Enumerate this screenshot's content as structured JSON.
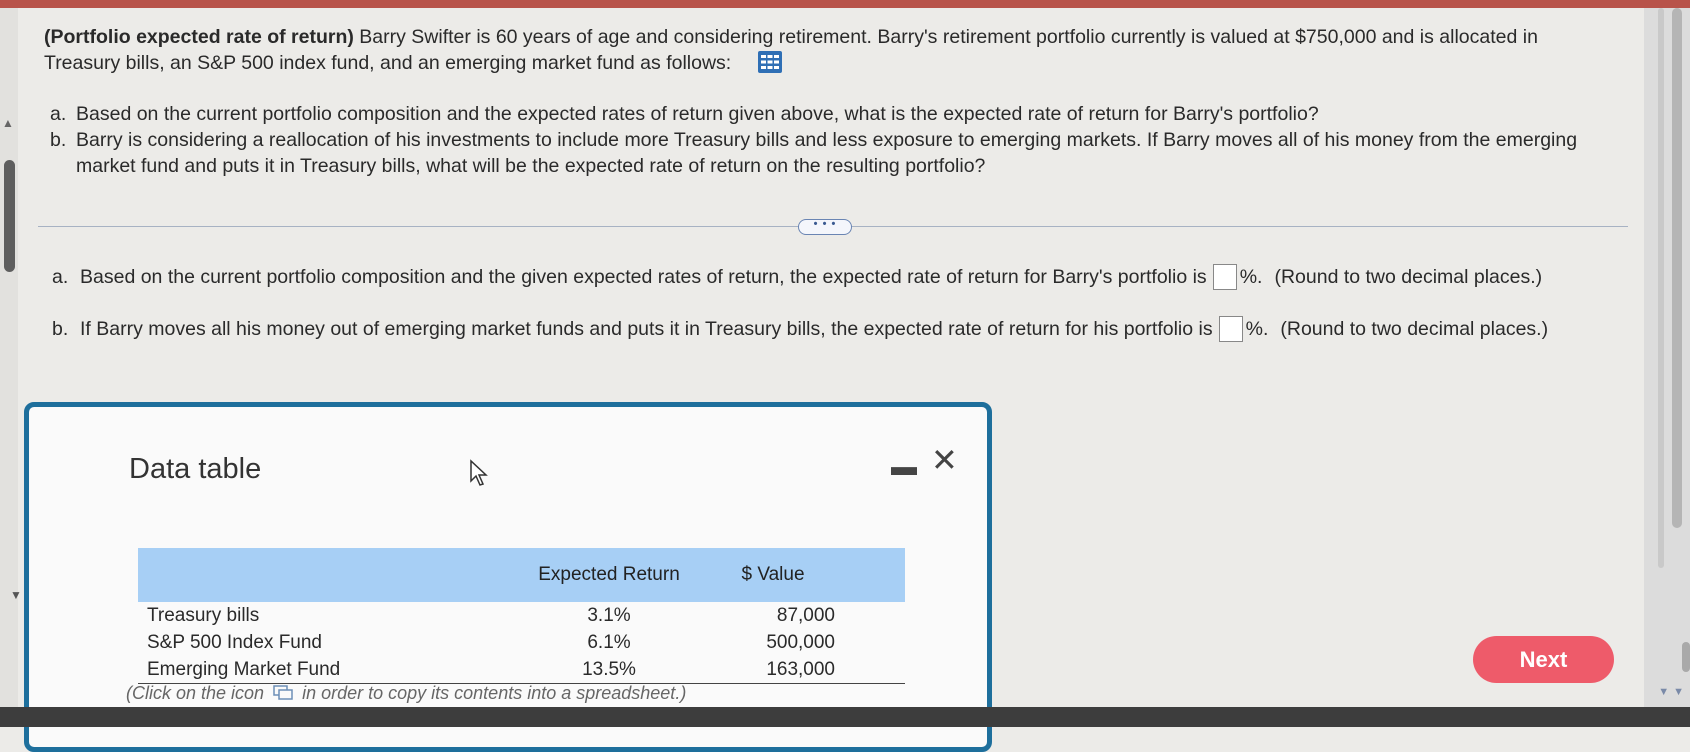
{
  "question": {
    "title": "(Portfolio expected rate of return)",
    "intro": "Barry Swifter is 60 years of age and considering retirement. Barry's retirement portfolio currently is valued at $750,000 and is allocated in Treasury bills, an S&P 500 index fund, and an emerging market fund as follows:",
    "parts": [
      {
        "label": "a.",
        "text": "Based on the current portfolio composition and the expected rates of return given above, what is the expected rate of return for Barry's portfolio?"
      },
      {
        "label": "b.",
        "text": "Barry is considering a reallocation of his investments to include more Treasury bills and less exposure to emerging markets. If Barry moves all of his money from the emerging market fund and puts it in Treasury bills, what will be the expected rate of return on the resulting portfolio?"
      }
    ]
  },
  "more_label": "• • •",
  "answers": [
    {
      "label": "a.",
      "prefix": "Based on the current portfolio composition and the given expected rates of return, the expected rate of return for Barry's portfolio is",
      "value": "",
      "suffix": "%.",
      "hint": "(Round to two decimal places.)"
    },
    {
      "label": "b.",
      "prefix": "If Barry moves all his money out of emerging market funds and puts it in Treasury bills, the expected rate of return for his portfolio is",
      "value": "",
      "suffix": "%.",
      "hint": "(Round to two decimal places.)"
    }
  ],
  "dialog": {
    "title": "Data table",
    "minimize": "▬",
    "close": "✕",
    "table": {
      "headers": [
        "",
        "Expected Return",
        "$ Value"
      ],
      "rows": [
        [
          "Treasury bills",
          "3.1%",
          "87,000"
        ],
        [
          "S&P 500 Index Fund",
          "6.1%",
          "500,000"
        ],
        [
          "Emerging Market Fund",
          "13.5%",
          "163,000"
        ]
      ]
    },
    "caption_before": "(Click on the icon",
    "caption_after": "in order to copy its contents into a spreadsheet.)"
  },
  "next_label": "Next",
  "colors": {
    "accent_blue": "#1e6f9c",
    "table_header": "#a7cff5",
    "next_button": "#ee5b6a",
    "top_bar": "#b8534a"
  }
}
